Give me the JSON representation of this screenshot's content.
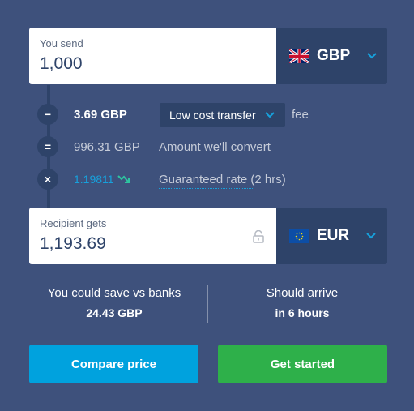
{
  "send": {
    "label": "You send",
    "value": "1,000",
    "currency": "GBP",
    "flag_icon": "uk-flag-icon"
  },
  "breakdown": {
    "fee_amount": "3.69 GBP",
    "fee_type": "Low cost transfer",
    "fee_suffix": "fee",
    "convert_amount": "996.31 GBP",
    "convert_label": "Amount we'll convert",
    "rate_value": "1.19811",
    "rate_label": "Guaranteed rate (2 hrs)",
    "symbols": {
      "minus": "−",
      "equals": "=",
      "times": "×"
    }
  },
  "receive": {
    "label": "Recipient gets",
    "value": "1,193.69",
    "currency": "EUR",
    "flag_icon": "eu-flag-icon"
  },
  "savings": {
    "title": "You could save vs banks",
    "value": "24.43 GBP"
  },
  "arrival": {
    "title": "Should arrive",
    "value": "in 6 hours"
  },
  "buttons": {
    "compare": "Compare price",
    "start": "Get started"
  },
  "colors": {
    "background": "#3e517c",
    "dark_panel": "#2e4369",
    "accent_blue": "#00a2de",
    "accent_green": "#2eb04a",
    "rate_blue": "#17a1dc",
    "trend_green": "#2ec4a0"
  }
}
